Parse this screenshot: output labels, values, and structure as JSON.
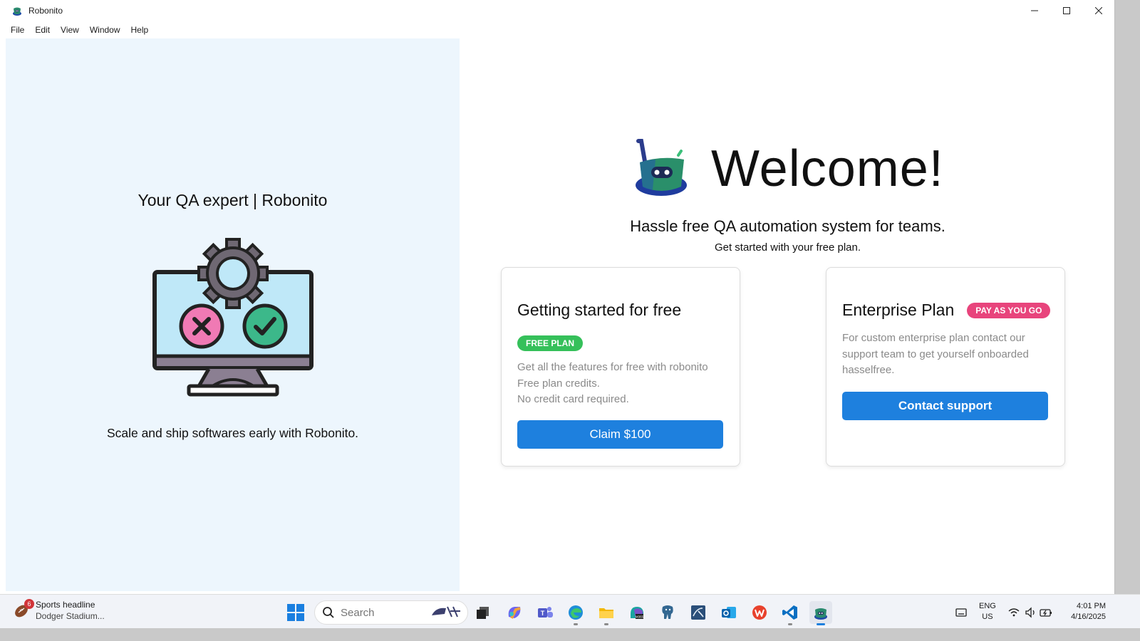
{
  "window": {
    "title": "Robonito",
    "controls": [
      "minimize",
      "maximize",
      "close"
    ]
  },
  "menu": [
    "File",
    "Edit",
    "View",
    "Window",
    "Help"
  ],
  "left_panel": {
    "title": "Your QA expert | Robonito",
    "subtitle": "Scale and ship softwares early with Robonito."
  },
  "hero": {
    "heading": "Welcome!",
    "tagline": "Hassle free QA automation system for teams.",
    "subline": "Get started with your free plan."
  },
  "free_card": {
    "title": "Getting started for free",
    "badge": "FREE PLAN",
    "lines": [
      "Get all the features for free with robonito",
      "Free plan credits.",
      "No credit card required."
    ],
    "button": "Claim $100"
  },
  "enterprise_card": {
    "title": "Enterprise Plan",
    "badge": "PAY AS YOU GO",
    "lines": [
      "For custom enterprise plan contact our",
      "support team to get yourself onboarded",
      "hasselfree."
    ],
    "button": "Contact support"
  },
  "taskbar": {
    "news_count": "6",
    "news_title": "Sports headline",
    "news_sub": "Dodger Stadium...",
    "search_placeholder": "Search",
    "lang_1": "ENG",
    "lang_2": "US",
    "time": "4:01 PM",
    "date": "4/16/2025"
  },
  "colors": {
    "accent_blue": "#1e80de",
    "free_green": "#35c05a",
    "pay_pink": "#e8447c",
    "left_panel_bg": "#edf6fd"
  },
  "icons": [
    "robonito-icon",
    "windows-start-icon",
    "search-icon",
    "task-view-icon",
    "copilot-icon",
    "teams-icon",
    "edge-icon",
    "file-explorer-icon",
    "m365-icon",
    "postgres-icon",
    "mysql-workbench-icon",
    "outlook-icon",
    "wps-icon",
    "vscode-icon",
    "robonito-taskbar-icon",
    "wifi-icon",
    "volume-icon",
    "battery-icon"
  ]
}
